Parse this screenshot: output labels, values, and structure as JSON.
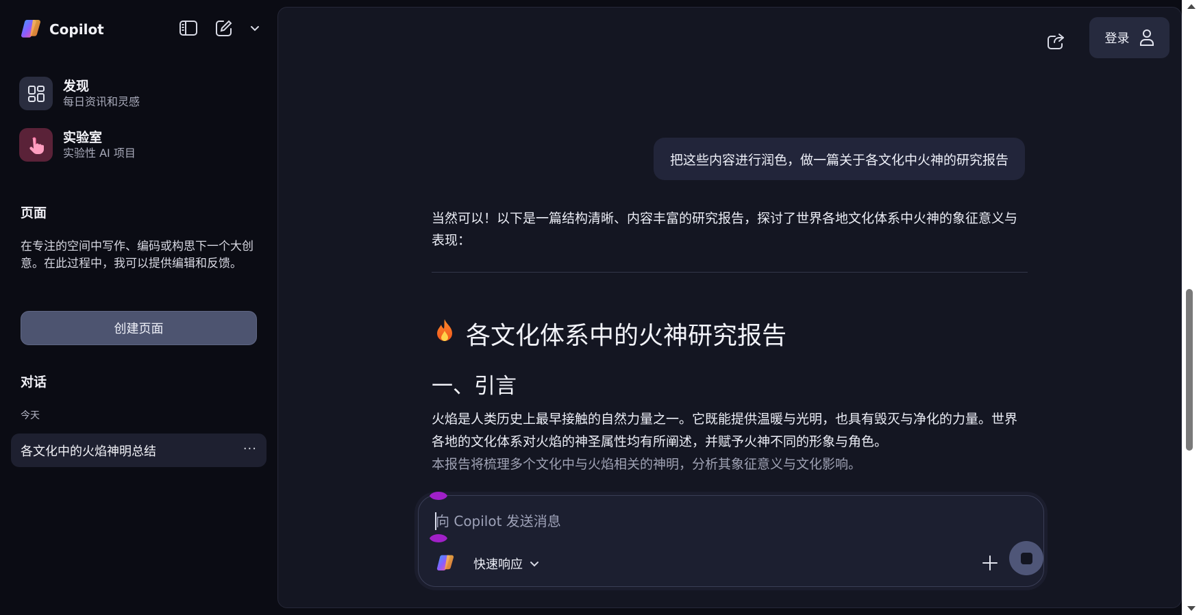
{
  "sidebar": {
    "brand": "Copilot",
    "nav": [
      {
        "title": "发现",
        "subtitle": "每日资讯和灵感"
      },
      {
        "title": "实验室",
        "subtitle": "实验性 AI 项目"
      }
    ],
    "pages_title": "页面",
    "pages_desc": "在专注的空间中写作、编码或构思下一个大创意。在此过程中，我可以提供编辑和反馈。",
    "create_page_label": "创建页面",
    "conversations_title": "对话",
    "today_label": "今天",
    "conversations": [
      {
        "title": "各文化中的火焰神明总结",
        "more": "···"
      }
    ]
  },
  "header": {
    "login_label": "登录"
  },
  "chat": {
    "user_message": "把这些内容进行润色，做一篇关于各文化中火神的研究报告",
    "reply_intro": "当然可以！以下是一篇结构清晰、内容丰富的研究报告，探讨了世界各地文化体系中火神的象征意义与表现：",
    "report_title": "各文化体系中的火神研究报告",
    "section_heading": "一、引言",
    "paragraph_main": "火焰是人类历史上最早接触的自然力量之一。它既能提供温暖与光明，也具有毁灭与净化的力量。世界各地的文化体系对火焰的神圣属性均有所阐述，并赋予火神不同的形象与角色。",
    "paragraph_fade": "本报告将梳理多个文化中与火焰相关的神明，分析其象征意义与文化影响。"
  },
  "composer": {
    "placeholder": "向 Copilot 发送消息",
    "mode_label": "快速响应"
  },
  "colors": {
    "background": "#0b0c14",
    "panel": "#141622",
    "accent_marker": "#a020c8"
  }
}
